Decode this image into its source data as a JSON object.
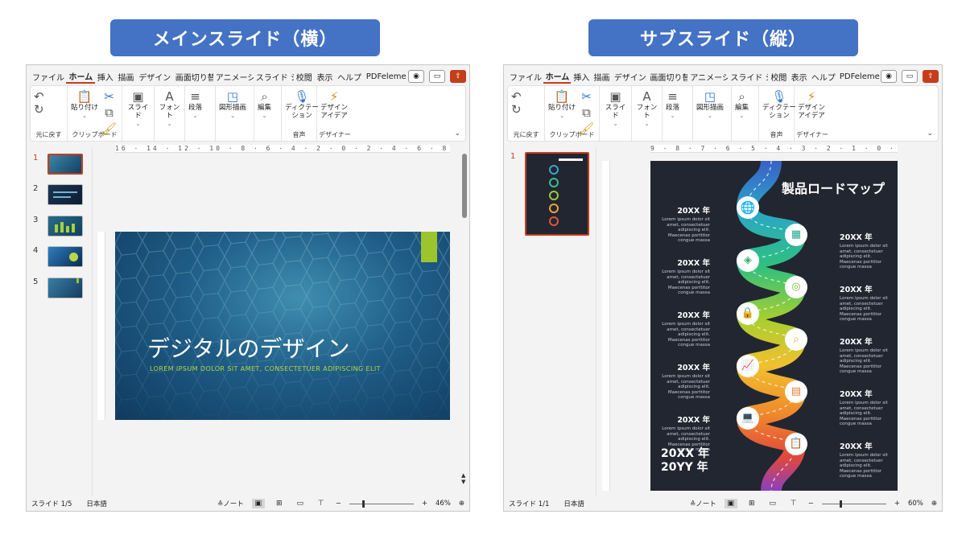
{
  "banners": {
    "left": "メインスライド（横）",
    "right": "サブスライド（縦）"
  },
  "tabs": [
    "ファイル",
    "ホーム",
    "挿入",
    "描画",
    "デザイン",
    "画面切り替",
    "アニメーショ",
    "スライド ショ",
    "校閲",
    "表示",
    "ヘルプ",
    "PDFeleme"
  ],
  "ribbon": {
    "undo_label": "元に戻す",
    "paste_label": "貼り付け",
    "clipboard_label": "クリップボード",
    "slide_label": "スライド",
    "font_label": "フォント",
    "paragraph_label": "段落",
    "shapes_label": "図形描画",
    "edit_label": "編集",
    "dictate_label": "ディクテー\nション",
    "voice_label": "音声",
    "designer_btn": "デザイン\nアイデア",
    "designer_label": "デザイナー"
  },
  "left_window": {
    "ruler_h": "16 · 14 · 12 · 10 · 8 · 6 · 4 · 2 · 0 · 2 · 4 · 6 · 8 · 10 · 12 · 14 · 16",
    "thumb_numbers": [
      "1",
      "2",
      "3",
      "4",
      "5"
    ],
    "slide": {
      "title": "デジタルのデザイン",
      "subtitle": "LOREM IPSUM DOLOR SIT AMET, CONSECTETUER ADIPISCING ELIT"
    },
    "status": {
      "slide_count": "スライド 1/5",
      "language": "日本語",
      "notes": "ノート",
      "zoom": "46%",
      "zoom_fraction": 0.46
    }
  },
  "right_window": {
    "ruler_h": "9 · 8 · 7 · 6 · 5 · 4 · 3 · 2 · 1 · 0 · 1 · 2 · 3 · 4 · 5 · 6 · 7 · 8 · 9",
    "thumb_numbers": [
      "1"
    ],
    "slide": {
      "title": "製品ロードマップ",
      "milestone_year": "20XX 年",
      "lorem": "Lorem ipsum dolor sit amet, consectetuer adipiscing elit. Maecenas porttitor congue massa",
      "final_line1": "20XX 年",
      "final_line2": "20YY 年"
    },
    "status": {
      "slide_count": "スライド 1/1",
      "language": "日本語",
      "notes": "ノート",
      "zoom": "60%",
      "zoom_fraction": 0.6
    }
  },
  "colors": {
    "banner": "#4472c4",
    "accent_tab": "#c43e1c",
    "slide_accent": "#9cc42d"
  }
}
